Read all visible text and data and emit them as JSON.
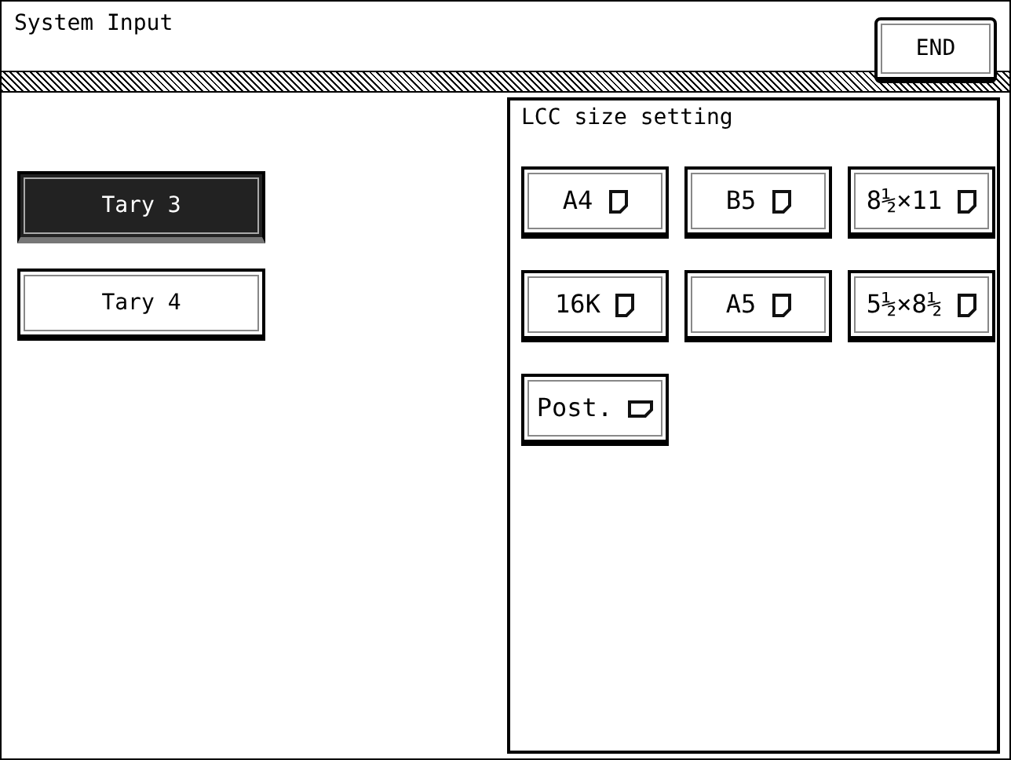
{
  "window": {
    "title": "System Input"
  },
  "end_button": {
    "label": "END"
  },
  "trays": [
    {
      "label": "Tary 3",
      "selected": true
    },
    {
      "label": "Tary 4",
      "selected": false
    }
  ],
  "lcc_panel": {
    "title": "LCC size setting",
    "sizes": [
      {
        "label": "A4",
        "kind": "portrait"
      },
      {
        "label": "B5",
        "kind": "portrait"
      },
      {
        "label": "8½×11",
        "kind": "portrait"
      },
      {
        "label": "16K",
        "kind": "portrait"
      },
      {
        "label": "A5",
        "kind": "portrait"
      },
      {
        "label": "5½×8½",
        "kind": "portrait"
      },
      {
        "label": "Post.",
        "kind": "landscape"
      }
    ]
  }
}
